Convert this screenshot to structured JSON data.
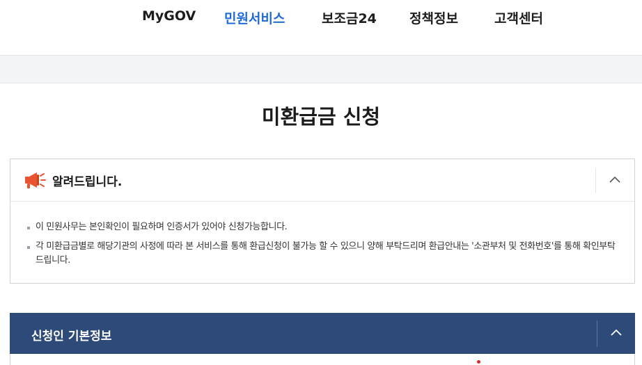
{
  "nav": {
    "items": [
      {
        "label": "MyGOV",
        "active": false
      },
      {
        "label": "민원서비스",
        "active": true
      },
      {
        "label": "보조금24",
        "active": false
      },
      {
        "label": "정책정보",
        "active": false
      },
      {
        "label": "고객센터",
        "active": false
      }
    ]
  },
  "page": {
    "title": "미환급금 신청"
  },
  "notice": {
    "title": "알려드립니다.",
    "lines": [
      "이 민원사무는 본인확인이 필요하며 인증서가 있어야 신청가능합니다.",
      "각 미환급금별로 해당기관의 사정에 따라 본 서비스를 통해 환급신청이 불가능 할 수 있으니 양해 부탁드리며 환급안내는 '소관부처 및 전화번호'를 통해 확인부탁드립니다."
    ]
  },
  "section": {
    "title": "신청인 기본정보"
  },
  "icons": {
    "megaphone": "megaphone-icon",
    "collapse": "chevron-up-icon"
  },
  "colors": {
    "accent": "#1f6ad4",
    "section_bar": "#2e4a79",
    "required": "#e0262b",
    "megaphone": "#e8542f"
  }
}
